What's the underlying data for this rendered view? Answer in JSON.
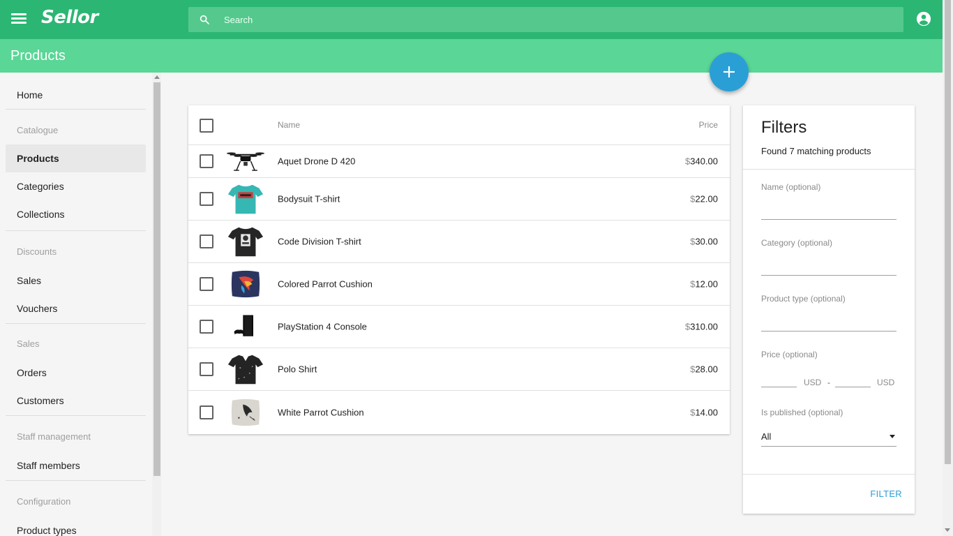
{
  "topbar": {
    "logo": "Sellor",
    "search_placeholder": "Search",
    "search_value": ""
  },
  "page": {
    "title": "Products"
  },
  "sidebar": {
    "home": "Home",
    "sections": {
      "catalogue": "Catalogue",
      "discounts": "Discounts",
      "sales": "Sales",
      "staff": "Staff management",
      "configuration": "Configuration"
    },
    "items": {
      "products": "Products",
      "categories": "Categories",
      "collections": "Collections",
      "sales": "Sales",
      "vouchers": "Vouchers",
      "orders": "Orders",
      "customers": "Customers",
      "staff_members": "Staff members",
      "product_types": "Product types"
    },
    "active": "products"
  },
  "table": {
    "headers": {
      "name": "Name",
      "price": "Price"
    },
    "currency_symbol": "$",
    "rows": [
      {
        "name": "Aquet Drone D 420",
        "price": "340.00",
        "thumb": "drone-icon"
      },
      {
        "name": "Bodysuit T-shirt",
        "price": "22.00",
        "thumb": "tshirt-teal-icon"
      },
      {
        "name": "Code Division T-shirt",
        "price": "30.00",
        "thumb": "tshirt-black-icon"
      },
      {
        "name": "Colored Parrot Cushion",
        "price": "12.00",
        "thumb": "cushion-colored-icon"
      },
      {
        "name": "PlayStation 4 Console",
        "price": "310.00",
        "thumb": "console-icon"
      },
      {
        "name": "Polo Shirt",
        "price": "28.00",
        "thumb": "polo-shirt-icon"
      },
      {
        "name": "White Parrot Cushion",
        "price": "14.00",
        "thumb": "cushion-white-icon"
      }
    ]
  },
  "filters": {
    "title": "Filters",
    "count_text": "Found 7 matching products",
    "name_label": "Name (optional)",
    "category_label": "Category (optional)",
    "product_type_label": "Product type (optional)",
    "price_label": "Price (optional)",
    "price_unit": "USD",
    "price_separator": "-",
    "published_label": "Is published (optional)",
    "published_value": "All",
    "submit_label": "FILTER"
  },
  "colors": {
    "primary": "#2bb673",
    "primary_light": "#5ad696",
    "accent": "#2a9fd6"
  }
}
